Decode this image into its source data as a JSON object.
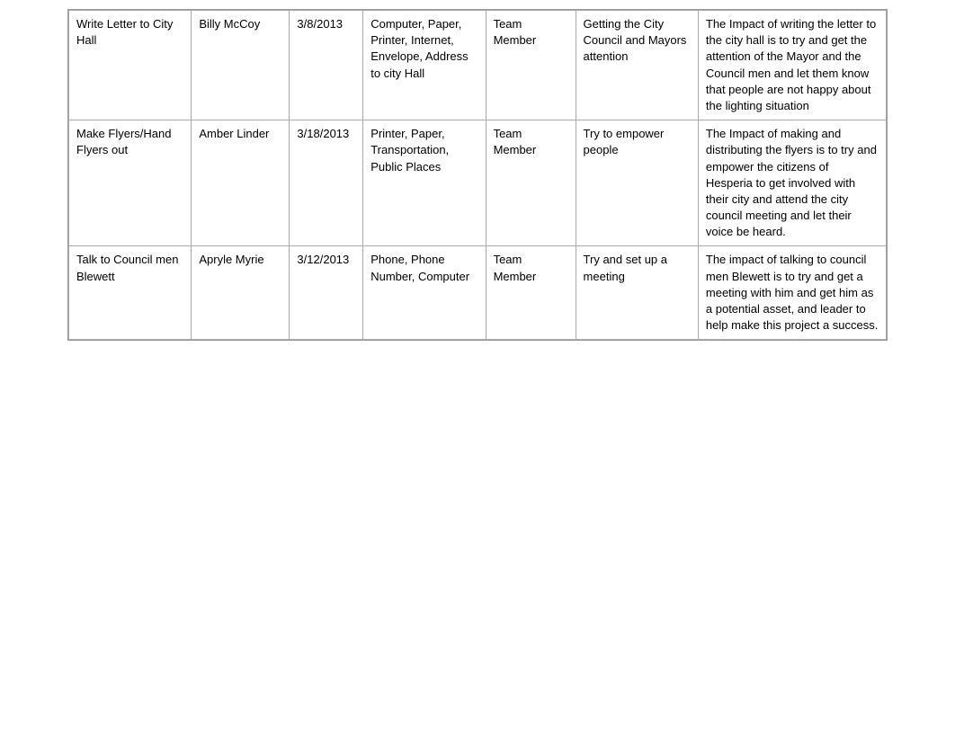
{
  "table": {
    "rows": [
      {
        "task": "Write Letter to City Hall",
        "person": "Billy McCoy",
        "date": "3/8/2013",
        "resources": "Computer, Paper, Printer, Internet, Envelope, Address to city Hall",
        "role": "Team Member",
        "goal": "Getting the City Council and Mayors attention",
        "impact": "The Impact of writing the letter to the city hall is to try and get the attention of the Mayor and the Council men and let them know that people are not happy about the lighting situation"
      },
      {
        "task": "Make Flyers/Hand Flyers out",
        "person": "Amber Linder",
        "date": "3/18/2013",
        "resources": "Printer, Paper, Transportation, Public Places",
        "role": "Team Member",
        "goal": "Try to empower people",
        "impact": "The Impact of making and distributing the flyers is to try and empower the citizens of Hesperia to get involved with their city and attend the city council meeting and let their voice be heard."
      },
      {
        "task": "Talk to Council men Blewett",
        "person": "Apryle Myrie",
        "date": "3/12/2013",
        "resources": "Phone, Phone Number, Computer",
        "role": "Team Member",
        "goal": "Try and set up a meeting",
        "impact": "The impact of talking to council men Blewett is to try and get a meeting with him and get him as a potential asset, and leader to help make this project a success."
      }
    ]
  }
}
